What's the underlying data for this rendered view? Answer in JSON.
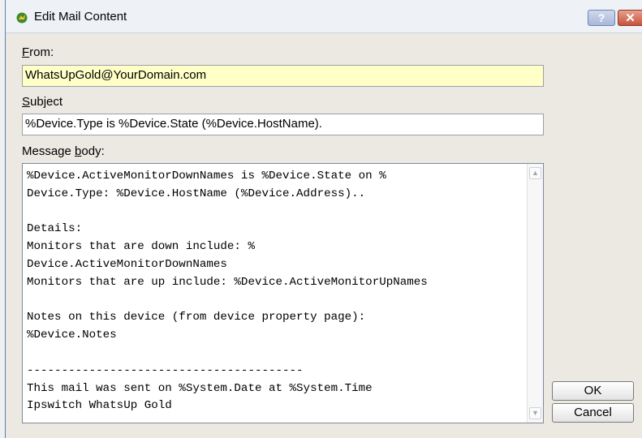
{
  "window": {
    "title": "Edit Mail Content",
    "help_label": "?",
    "close_label": "✕"
  },
  "from": {
    "label_accel": "F",
    "label_rest": "rom:",
    "value": "WhatsUpGold@YourDomain.com"
  },
  "subject": {
    "label_accel": "S",
    "label_rest": "ubject",
    "value": "%Device.Type is %Device.State (%Device.HostName)."
  },
  "message_body": {
    "label_pre": "Message ",
    "label_accel": "b",
    "label_post": "ody:",
    "text": "%Device.ActiveMonitorDownNames is %Device.State on %\nDevice.Type: %Device.HostName (%Device.Address)..\n\nDetails:\nMonitors that are down include: %\nDevice.ActiveMonitorDownNames\nMonitors that are up include: %Device.ActiveMonitorUpNames\n\nNotes on this device (from device property page):\n%Device.Notes\n\n----------------------------------------\nThis mail was sent on %System.Date at %System.Time\nIpswitch WhatsUp Gold"
  },
  "buttons": {
    "ok": "OK",
    "cancel": "Cancel"
  },
  "colors": {
    "from_field_bg": "#ffffc8",
    "dialog_bg": "#ebe9e2",
    "close_button": "#c8533b"
  },
  "icons": {
    "app": "whatsup-gold-icon",
    "scroll_up": "scroll-up-arrow-icon",
    "scroll_down": "scroll-down-arrow-icon"
  }
}
